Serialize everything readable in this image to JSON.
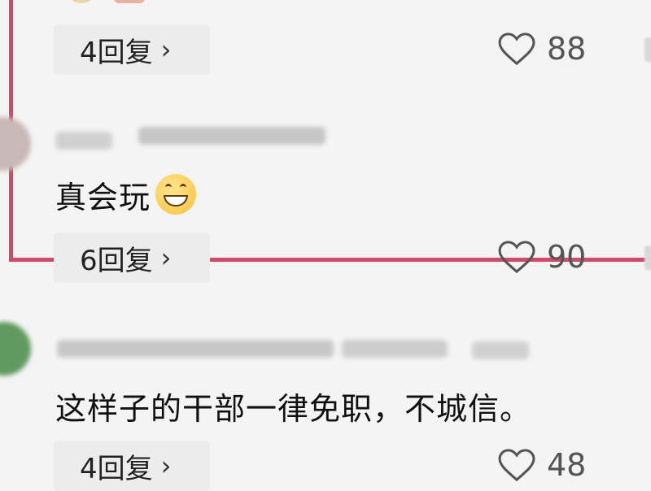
{
  "comments": [
    {
      "reply_label": "4回复",
      "chevron": "›",
      "like_count": "88"
    },
    {
      "text": "真会玩",
      "emoji": "grinning-face-emoji",
      "reply_label": "6回复",
      "chevron": "›",
      "like_count": "90"
    },
    {
      "text": "这样子的干部一律免职，不城信。",
      "reply_label": "4回复",
      "chevron": "›",
      "like_count": "48"
    }
  ],
  "colors": {
    "background": "#f4f4f4",
    "highlight_border": "#cf4a66",
    "reply_button_bg": "#ececec"
  },
  "icons": [
    "heart-outline-icon",
    "chevron-right-icon"
  ]
}
